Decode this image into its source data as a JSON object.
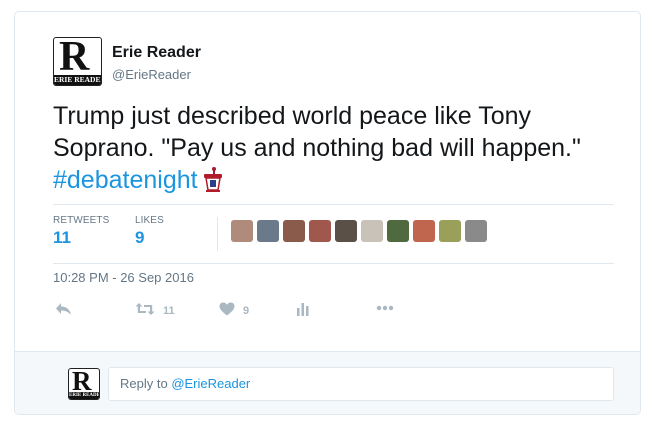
{
  "author": {
    "name": "Erie Reader",
    "handle": "@ErieReader",
    "logo_letter": "R",
    "logo_band": "ERIE READER"
  },
  "tweet": {
    "text": "Trump just described world peace like Tony Soprano. \"Pay us and nothing bad will happen.\"",
    "hashtag": "#debatenight",
    "hashtag_icon": "podium-icon"
  },
  "stats": {
    "retweets_label": "RETWEETS",
    "retweets_value": "11",
    "likes_label": "LIKES",
    "likes_value": "9"
  },
  "likers": [
    {
      "color": "#b08a7a"
    },
    {
      "color": "#6b7a8a"
    },
    {
      "color": "#8a5a4a"
    },
    {
      "color": "#a0584c"
    },
    {
      "color": "#5a5048"
    },
    {
      "color": "#c9c2b8"
    },
    {
      "color": "#4f6a3e"
    },
    {
      "color": "#c0664e"
    },
    {
      "color": "#9aa05a"
    },
    {
      "color": "#8a8a8a"
    }
  ],
  "timestamp": "10:28 PM - 26 Sep 2016",
  "actions": {
    "reply_icon": "reply-icon",
    "retweet_icon": "retweet-icon",
    "retweet_count": "11",
    "like_icon": "heart-icon",
    "like_count": "9",
    "analytics_icon": "analytics-icon",
    "more_icon": "more-icon"
  },
  "reply": {
    "prefix": "Reply to ",
    "mention": "@ErieReader"
  },
  "colors": {
    "accent": "#1b95e0",
    "muted": "#657786",
    "icon_muted": "#aab8c2",
    "border": "#e1e8ed",
    "reply_bg": "#f5f8fa"
  }
}
